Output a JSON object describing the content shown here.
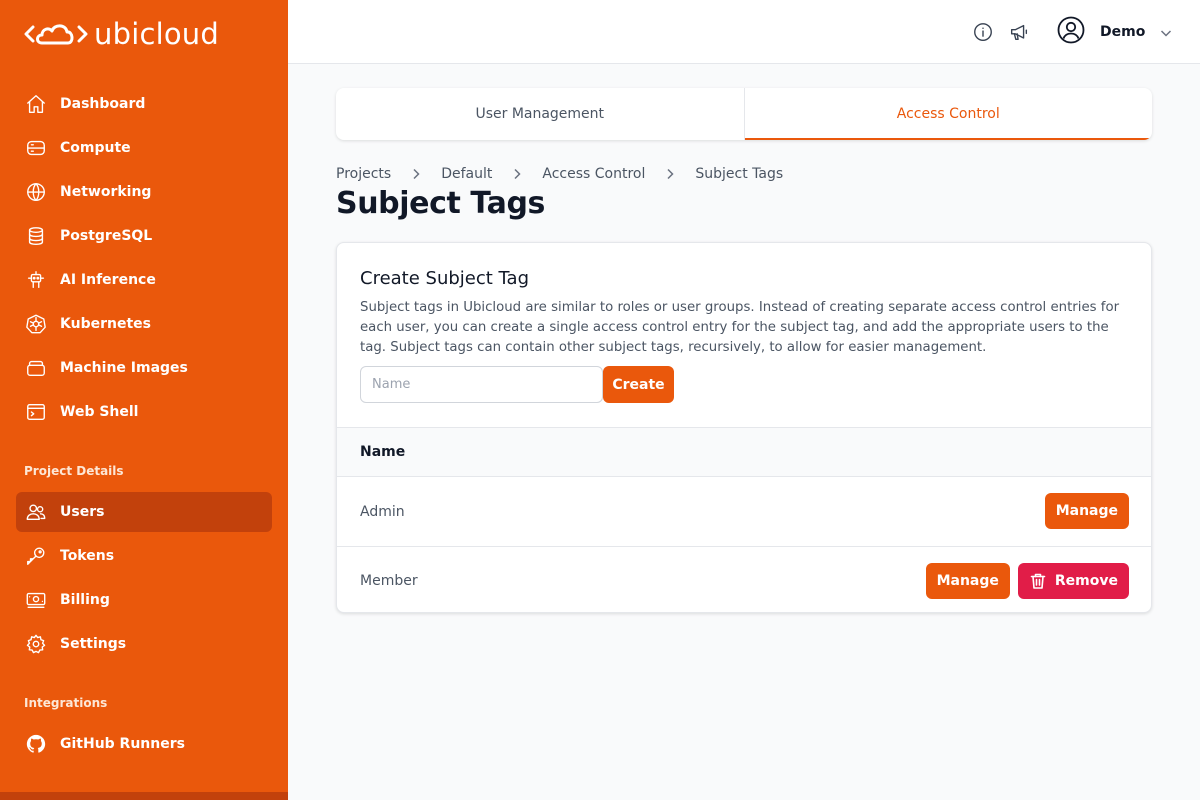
{
  "brand": {
    "name": "ubicloud"
  },
  "sidebar": {
    "main_items": [
      {
        "label": "Dashboard",
        "icon": "home-icon"
      },
      {
        "label": "Compute",
        "icon": "server-icon"
      },
      {
        "label": "Networking",
        "icon": "globe-icon"
      },
      {
        "label": "PostgreSQL",
        "icon": "database-icon"
      },
      {
        "label": "AI Inference",
        "icon": "robot-icon"
      },
      {
        "label": "Kubernetes",
        "icon": "kubernetes-icon"
      },
      {
        "label": "Machine Images",
        "icon": "stack-icon"
      },
      {
        "label": "Web Shell",
        "icon": "terminal-icon"
      }
    ],
    "project_section_label": "Project Details",
    "project_items": [
      {
        "label": "Users",
        "icon": "users-icon",
        "active": true
      },
      {
        "label": "Tokens",
        "icon": "key-icon"
      },
      {
        "label": "Billing",
        "icon": "banknote-icon"
      },
      {
        "label": "Settings",
        "icon": "gear-icon"
      }
    ],
    "integrations_section_label": "Integrations",
    "integration_items": [
      {
        "label": "GitHub Runners",
        "icon": "github-icon"
      }
    ]
  },
  "header": {
    "user_name": "Demo",
    "icons": [
      "info-icon",
      "megaphone-icon",
      "user-circle-icon",
      "chevron-down-icon"
    ]
  },
  "tabs": [
    {
      "label": "User Management",
      "active": false
    },
    {
      "label": "Access Control",
      "active": true
    }
  ],
  "breadcrumb": [
    "Projects",
    "Default",
    "Access Control",
    "Subject Tags"
  ],
  "page_title": "Subject Tags",
  "create_section": {
    "title": "Create Subject Tag",
    "description": "Subject tags in Ubicloud are similar to roles or user groups. Instead of creating separate access control entries for each user, you can create a single access control entry for the subject tag, and add the appropriate users to the tag. Subject tags can contain other subject tags, recursively, to allow for easier management.",
    "name_placeholder": "Name",
    "name_value": "",
    "create_label": "Create"
  },
  "table": {
    "column_header": "Name",
    "rows": [
      {
        "name": "Admin",
        "manage_label": "Manage"
      },
      {
        "name": "Member",
        "manage_label": "Manage",
        "remove_label": "Remove"
      }
    ]
  },
  "colors": {
    "accent": "#ea580c",
    "accent_dark": "#c2410c",
    "danger": "#e11d48"
  }
}
